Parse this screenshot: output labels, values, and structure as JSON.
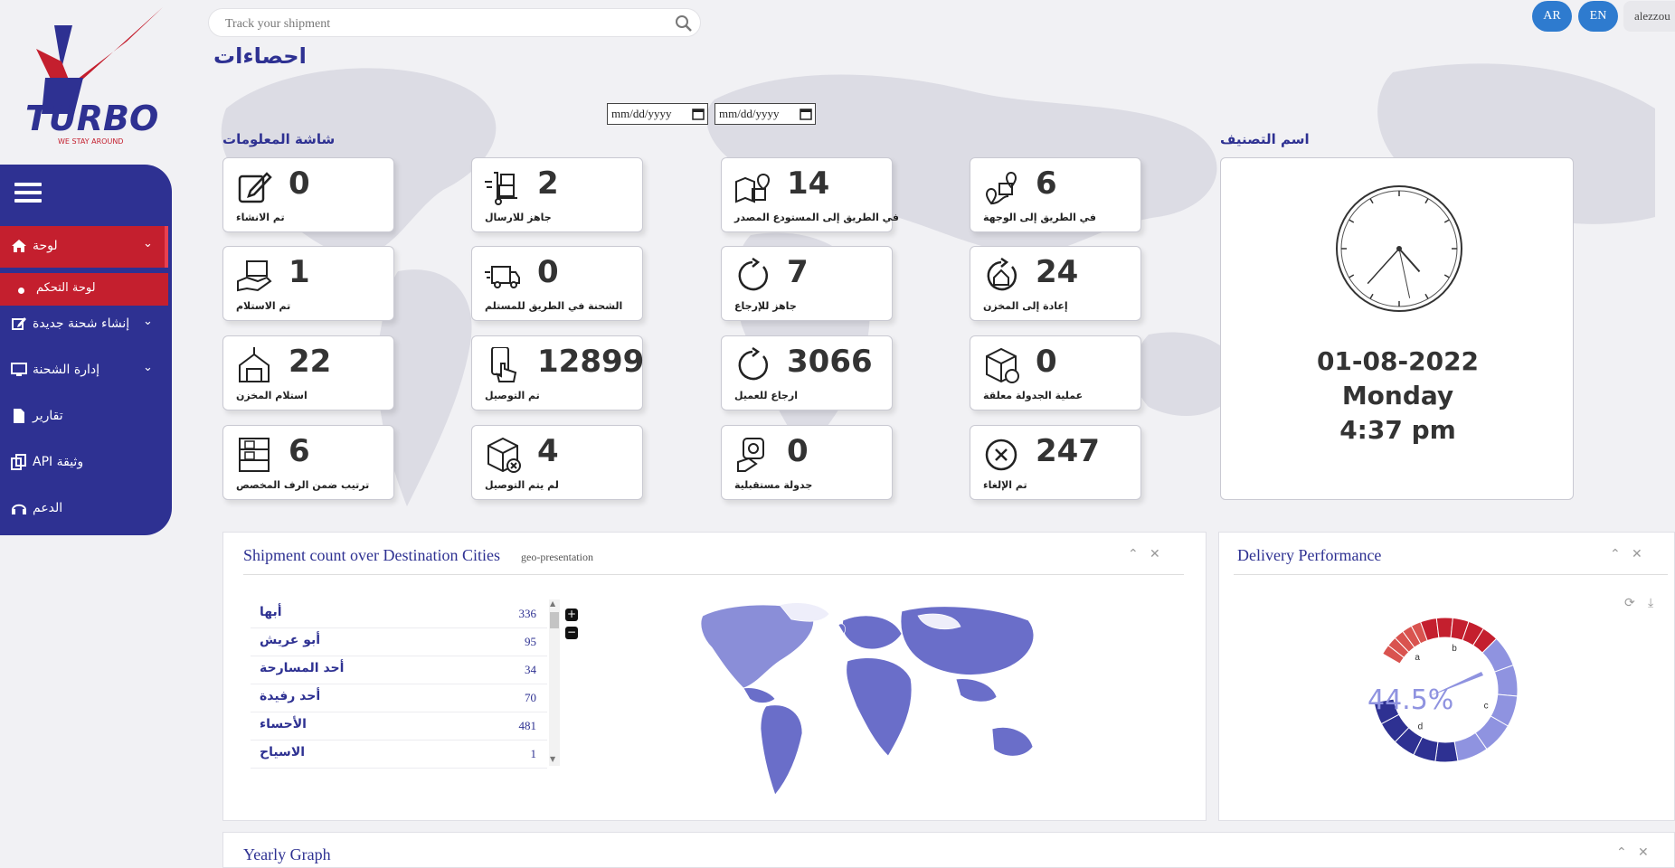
{
  "brand": {
    "name": "TURBO",
    "tagline": "WE STAY AROUND"
  },
  "search": {
    "placeholder": "Track your shipment"
  },
  "header": {
    "lang_ar": "AR",
    "lang_en": "EN",
    "user": "alezzou"
  },
  "page_title": "احصاءات",
  "date_from": {
    "placeholder": "mm/dd/yyyy"
  },
  "date_to": {
    "placeholder": "mm/dd/yyyy"
  },
  "sections": {
    "info": "شاشة المعلومات",
    "classification": "اسم التصنيف"
  },
  "sidebar": {
    "items": [
      {
        "label": "لوحة",
        "icon": "home-icon",
        "expandable": true,
        "active": true
      },
      {
        "label": "لوحة التحكم",
        "icon": "dot-icon",
        "sub": true,
        "active": true
      },
      {
        "label": "إنشاء شحنة جديدة",
        "icon": "edit-icon",
        "expandable": true
      },
      {
        "label": "إدارة الشحنة",
        "icon": "monitor-icon",
        "expandable": true
      },
      {
        "label": "تقارير",
        "icon": "file-icon"
      },
      {
        "label": "API وثيقة",
        "icon": "copy-icon"
      },
      {
        "label": "الدعم",
        "icon": "headset-icon"
      }
    ]
  },
  "stats": [
    {
      "value": "0",
      "label": "تم الانشاء",
      "icon": "edit-icon"
    },
    {
      "value": "2",
      "label": "جاهز للارسال",
      "icon": "dolly-icon"
    },
    {
      "value": "14",
      "label": "في الطريق إلى المستودع المصدر",
      "icon": "map-box-icon"
    },
    {
      "value": "6",
      "label": "في الطريق إلى الوجهة",
      "icon": "route-icon"
    },
    {
      "value": "1",
      "label": "تم الاستلام",
      "icon": "hand-box-icon"
    },
    {
      "value": "0",
      "label": "الشحنة في الطريق للمستلم",
      "icon": "truck-icon"
    },
    {
      "value": "7",
      "label": "جاهز للإرجاع",
      "icon": "return-icon"
    },
    {
      "value": "24",
      "label": "إعادة إلى المخزن",
      "icon": "home-return-icon"
    },
    {
      "value": "22",
      "label": "استلام المخزن",
      "icon": "warehouse-icon"
    },
    {
      "value": "12899",
      "label": "تم التوصيل",
      "icon": "phone-tap-icon"
    },
    {
      "value": "3066",
      "label": "ارجاع للعميل",
      "icon": "refresh-icon"
    },
    {
      "value": "0",
      "label": "عملية الجدولة معلقة",
      "icon": "box-clock-icon"
    },
    {
      "value": "6",
      "label": "ترتيب ضمن الرف المخصص",
      "icon": "shelf-icon"
    },
    {
      "value": "4",
      "label": "لم يتم التوصيل",
      "icon": "box-x-icon"
    },
    {
      "value": "0",
      "label": "جدولة مستقبلية",
      "icon": "calendar-hand-icon"
    },
    {
      "value": "247",
      "label": "تم الإلغاء",
      "icon": "cancel-icon"
    }
  ],
  "clock": {
    "date": "01-08-2022",
    "day": "Monday",
    "time": "4:37 pm",
    "hour": 4,
    "minute": 37,
    "second": 28
  },
  "geo_panel": {
    "title": "Shipment count over Destination Cities",
    "subtitle": "geo-presentation",
    "cities": [
      {
        "name": "أبها",
        "count": "336"
      },
      {
        "name": "أبو عريش",
        "count": "95"
      },
      {
        "name": "أحد المسارحة",
        "count": "34"
      },
      {
        "name": "أحد رفيدة",
        "count": "70"
      },
      {
        "name": "الأحساء",
        "count": "481"
      },
      {
        "name": "الاسياح",
        "count": "1"
      }
    ],
    "zoom_in": "+",
    "zoom_out": "−"
  },
  "delivery_panel": {
    "title": "Delivery Performance",
    "percent": "44.5%",
    "segments": [
      "a",
      "b",
      "c",
      "d"
    ],
    "colors": {
      "red": "#c41f2e",
      "light_red": "#d9534f",
      "blue": "#2e3192",
      "light_blue": "#8f93e0"
    }
  },
  "yearly_panel": {
    "title": "Yearly Graph"
  }
}
